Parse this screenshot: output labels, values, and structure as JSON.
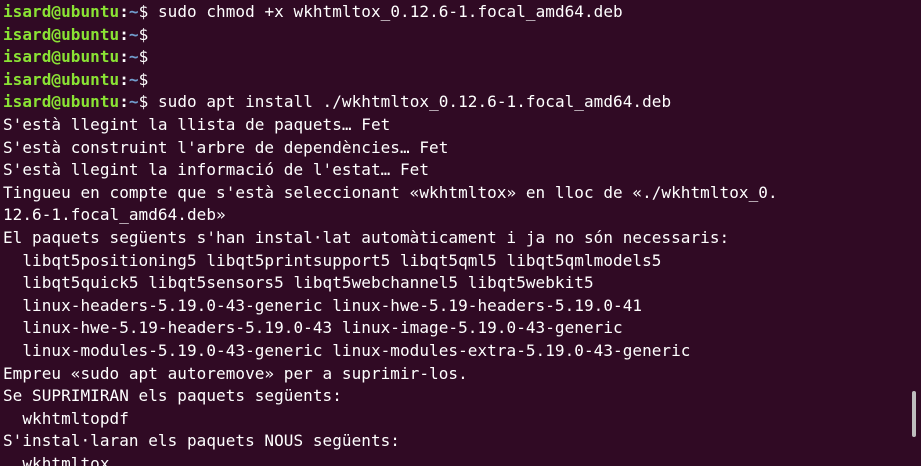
{
  "terminal": {
    "prompt": {
      "user_host": "isard@ubuntu",
      "separator": ":",
      "path": "~",
      "symbol": "$"
    },
    "lines": [
      {
        "type": "prompt",
        "command": " sudo chmod +x wkhtmltox_0.12.6-1.focal_amd64.deb"
      },
      {
        "type": "prompt",
        "command": ""
      },
      {
        "type": "prompt",
        "command": ""
      },
      {
        "type": "prompt",
        "command": ""
      },
      {
        "type": "prompt",
        "command": " sudo apt install ./wkhtmltox_0.12.6-1.focal_amd64.deb"
      },
      {
        "type": "output",
        "text": "S'està llegint la llista de paquets… Fet"
      },
      {
        "type": "output",
        "text": "S'està construint l'arbre de dependències… Fet"
      },
      {
        "type": "output",
        "text": "S'està llegint la informació de l'estat… Fet"
      },
      {
        "type": "output",
        "text": "Tingueu en compte que s'està seleccionant «wkhtmltox» en lloc de «./wkhtmltox_0."
      },
      {
        "type": "output",
        "text": "12.6-1.focal_amd64.deb»"
      },
      {
        "type": "output",
        "text": "El paquets següents s'han instal·lat automàticament i ja no són necessaris:"
      },
      {
        "type": "output",
        "text": "  libqt5positioning5 libqt5printsupport5 libqt5qml5 libqt5qmlmodels5"
      },
      {
        "type": "output",
        "text": "  libqt5quick5 libqt5sensors5 libqt5webchannel5 libqt5webkit5"
      },
      {
        "type": "output",
        "text": "  linux-headers-5.19.0-43-generic linux-hwe-5.19-headers-5.19.0-41"
      },
      {
        "type": "output",
        "text": "  linux-hwe-5.19-headers-5.19.0-43 linux-image-5.19.0-43-generic"
      },
      {
        "type": "output",
        "text": "  linux-modules-5.19.0-43-generic linux-modules-extra-5.19.0-43-generic"
      },
      {
        "type": "output",
        "text": "Empreu «sudo apt autoremove» per a suprimir-los."
      },
      {
        "type": "output",
        "text": "Se SUPRIMIRAN els paquets següents:"
      },
      {
        "type": "output",
        "text": "  wkhtmltopdf"
      },
      {
        "type": "output",
        "text": "S'instal·laran els paquets NOUS següents:"
      },
      {
        "type": "output",
        "text": "  wkhtmltox"
      }
    ]
  },
  "colors": {
    "background": "#300a24",
    "prompt_user": "#8ae234",
    "prompt_path": "#729fcf",
    "text": "#ffffff",
    "scrollbar": "#bdbdbd"
  }
}
